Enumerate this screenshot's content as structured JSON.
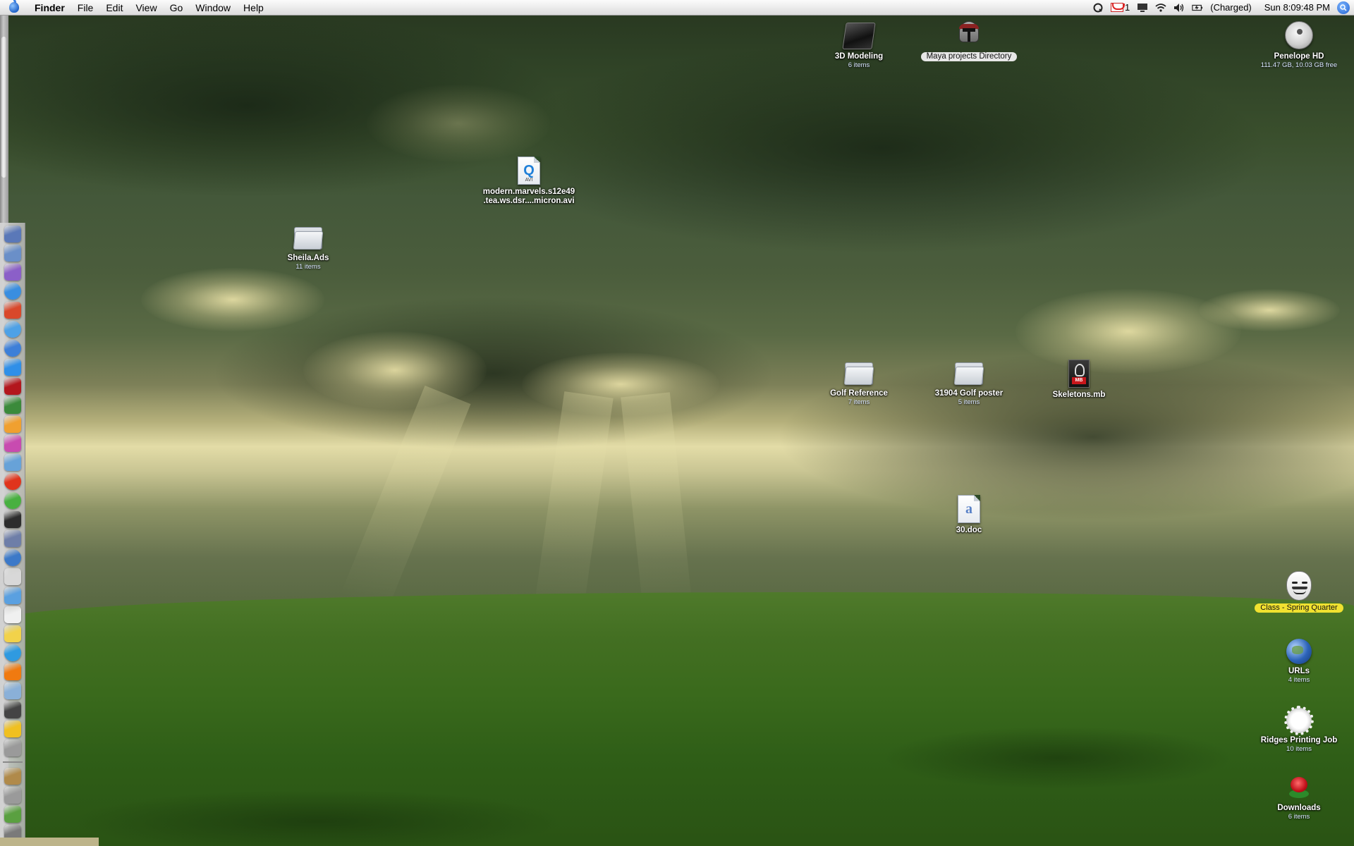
{
  "menubar": {
    "apple_icon": "apple-icon",
    "app_name": "Finder",
    "menus": [
      "File",
      "Edit",
      "View",
      "Go",
      "Window",
      "Help"
    ],
    "status": {
      "gmail_count": "1",
      "battery_text": "(Charged)",
      "clock": "Sun 8:09:48 PM"
    }
  },
  "dock": {
    "icon_colors": [
      "#5a78b8",
      "#6a8fc8",
      "#8b5fc8",
      "#3a8ee0",
      "#d9482b",
      "#4ea1e6",
      "#3d7fd8",
      "#2f8fe8",
      "#b3161d",
      "#3b8a3b",
      "#f0a030",
      "#c84bb0",
      "#67a2d8",
      "#e0341c",
      "#48b040",
      "#2d2d2d",
      "#6e7ea8",
      "#3c79c8",
      "#d8d8d8",
      "#5aa0e0",
      "#f0f0f0",
      "#f2d24a",
      "#2f9ae0",
      "#f07a10",
      "#8ab0d8",
      "#444444",
      "#f0c020",
      "#9a9a9a"
    ],
    "bottom_icon_colors": [
      "#b08a4a",
      "#9a9a9a",
      "#5aa040",
      "#7a7a7a"
    ]
  },
  "desktop": {
    "icons": {
      "modeling3d": {
        "label": "3D Modeling",
        "sub": "6 items"
      },
      "maya": {
        "label": "Maya projects Directory"
      },
      "penelope": {
        "label": "Penelope HD",
        "sub": "111.47 GB, 10.03 GB free"
      },
      "avi": {
        "label_line1": "modern.marvels.s12e49",
        "label_line2": ".tea.ws.dsr....micron.avi",
        "tag": "AVI"
      },
      "sheila": {
        "label": "Sheila.Ads",
        "sub": "11 items"
      },
      "golf_ref": {
        "label": "Golf Reference",
        "sub": "7 items"
      },
      "golf_poster": {
        "label": "31904 Golf poster",
        "sub": "5 items"
      },
      "skeletons": {
        "label": "Skeletons.mb",
        "tag": "MB"
      },
      "doc30": {
        "label": "30.doc"
      },
      "class_spring": {
        "label": "Class - Spring Quarter"
      },
      "urls": {
        "label": "URLs",
        "sub": "4 items"
      },
      "ridges": {
        "label": "Ridges Printing Job",
        "sub": "10 items"
      },
      "downloads": {
        "label": "Downloads",
        "sub": "6 items"
      }
    }
  }
}
